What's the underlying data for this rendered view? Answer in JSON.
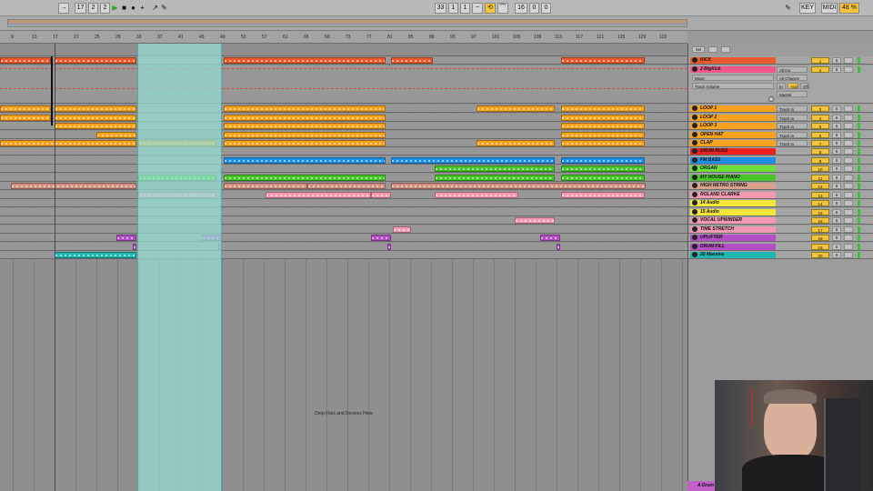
{
  "transport": {
    "tempo_fields": [
      "17",
      "2",
      "2"
    ],
    "position_fields": [
      "33",
      "1",
      "1"
    ],
    "loop_length_fields": [
      "16",
      "0",
      "0"
    ],
    "key_label": "KEY",
    "midi_label": "MIDI",
    "cpu_label": "48 %"
  },
  "ruler": {
    "ticks": [
      "9",
      "13",
      "17",
      "21",
      "25",
      "29",
      "33",
      "37",
      "41",
      "45",
      "49",
      "53",
      "57",
      "61",
      "65",
      "69",
      "73",
      "77",
      "81",
      "85",
      "89",
      "93",
      "97",
      "101",
      "105",
      "109",
      "113",
      "117",
      "121",
      "125",
      "129",
      "133"
    ]
  },
  "arrangement": {
    "drop_text": "Drop Files and Devices Here"
  },
  "headers": {
    "set_label": "Set",
    "mixer_label": "Mixer",
    "all_ins": "All Ins",
    "all_channels": "All Channe",
    "track_volume": "Track Volume",
    "in_label": "In",
    "auto_label": "Auto",
    "off_label": "Off",
    "master_label": "Master"
  },
  "tracks": [
    {
      "name": "KICK",
      "num": "1",
      "io": "",
      "color": "#ef5a2c"
    },
    {
      "name": "2 BigKick",
      "num": "2",
      "io": "All Ins",
      "color": "#f2588a"
    },
    {
      "name": "LOOP 1",
      "num": "3",
      "io": "Track In",
      "color": "#f7a21c"
    },
    {
      "name": "LOOP 2",
      "num": "4",
      "io": "Track In",
      "color": "#f7a21c"
    },
    {
      "name": "LOOP 3",
      "num": "5",
      "io": "Track In",
      "color": "#f7a21c"
    },
    {
      "name": "OPEN HAT",
      "num": "6",
      "io": "Track In",
      "color": "#f7a21c"
    },
    {
      "name": "CLAP",
      "num": "7",
      "io": "Track In",
      "color": "#f7a21c"
    },
    {
      "name": "DRUM BUSS",
      "num": "8",
      "io": "",
      "color": "#ee1f1f"
    },
    {
      "name": "FM BASS",
      "num": "9",
      "io": "",
      "color": "#1c8fe8"
    },
    {
      "name": "ORGAN",
      "num": "10",
      "io": "",
      "color": "#6be03a"
    },
    {
      "name": "MY HOUSE PIANO",
      "num": "11",
      "io": "",
      "color": "#47c52a"
    },
    {
      "name": "HIGH RETRO STRING",
      "num": "12",
      "io": "",
      "color": "#d9a08c"
    },
    {
      "name": "ROLAND CLARKE",
      "num": "13",
      "io": "",
      "color": "#f39ab0"
    },
    {
      "name": "14 Audio",
      "num": "14",
      "io": "",
      "color": "#f5e63a"
    },
    {
      "name": "15 Audio",
      "num": "15",
      "io": "",
      "color": "#f5e63a"
    },
    {
      "name": "VOCAL UPWINDER",
      "num": "16",
      "io": "",
      "color": "#f39ab0"
    },
    {
      "name": "TIME STRETCH",
      "num": "17",
      "io": "",
      "color": "#f39ab0"
    },
    {
      "name": "UPLIFTER",
      "num": "18",
      "io": "",
      "color": "#b34fc4"
    },
    {
      "name": "DRUM FILL",
      "num": "19",
      "io": "",
      "color": "#b34fc4"
    },
    {
      "name": "20 Massive",
      "num": "20",
      "io": "",
      "color": "#1fb8b0"
    }
  ],
  "bottom_track": {
    "name": "A Drum",
    "color": "#c25fc9"
  },
  "colors": {
    "orange": "#f7a21c",
    "red": "#ef5a2c",
    "blue": "#1c8fe8",
    "green": "#47c52a",
    "pink": "#f39ab0",
    "purple": "#b34fc4",
    "teal": "#1fb8b0",
    "loop_region": "#96dcd2"
  }
}
